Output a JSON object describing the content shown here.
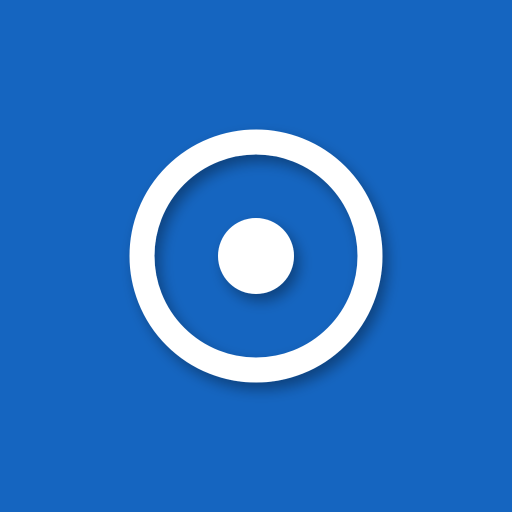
{
  "icon": {
    "name": "radio-button-checked-icon",
    "colors": {
      "background": "#1565C0",
      "foreground": "#FFFFFF"
    }
  }
}
